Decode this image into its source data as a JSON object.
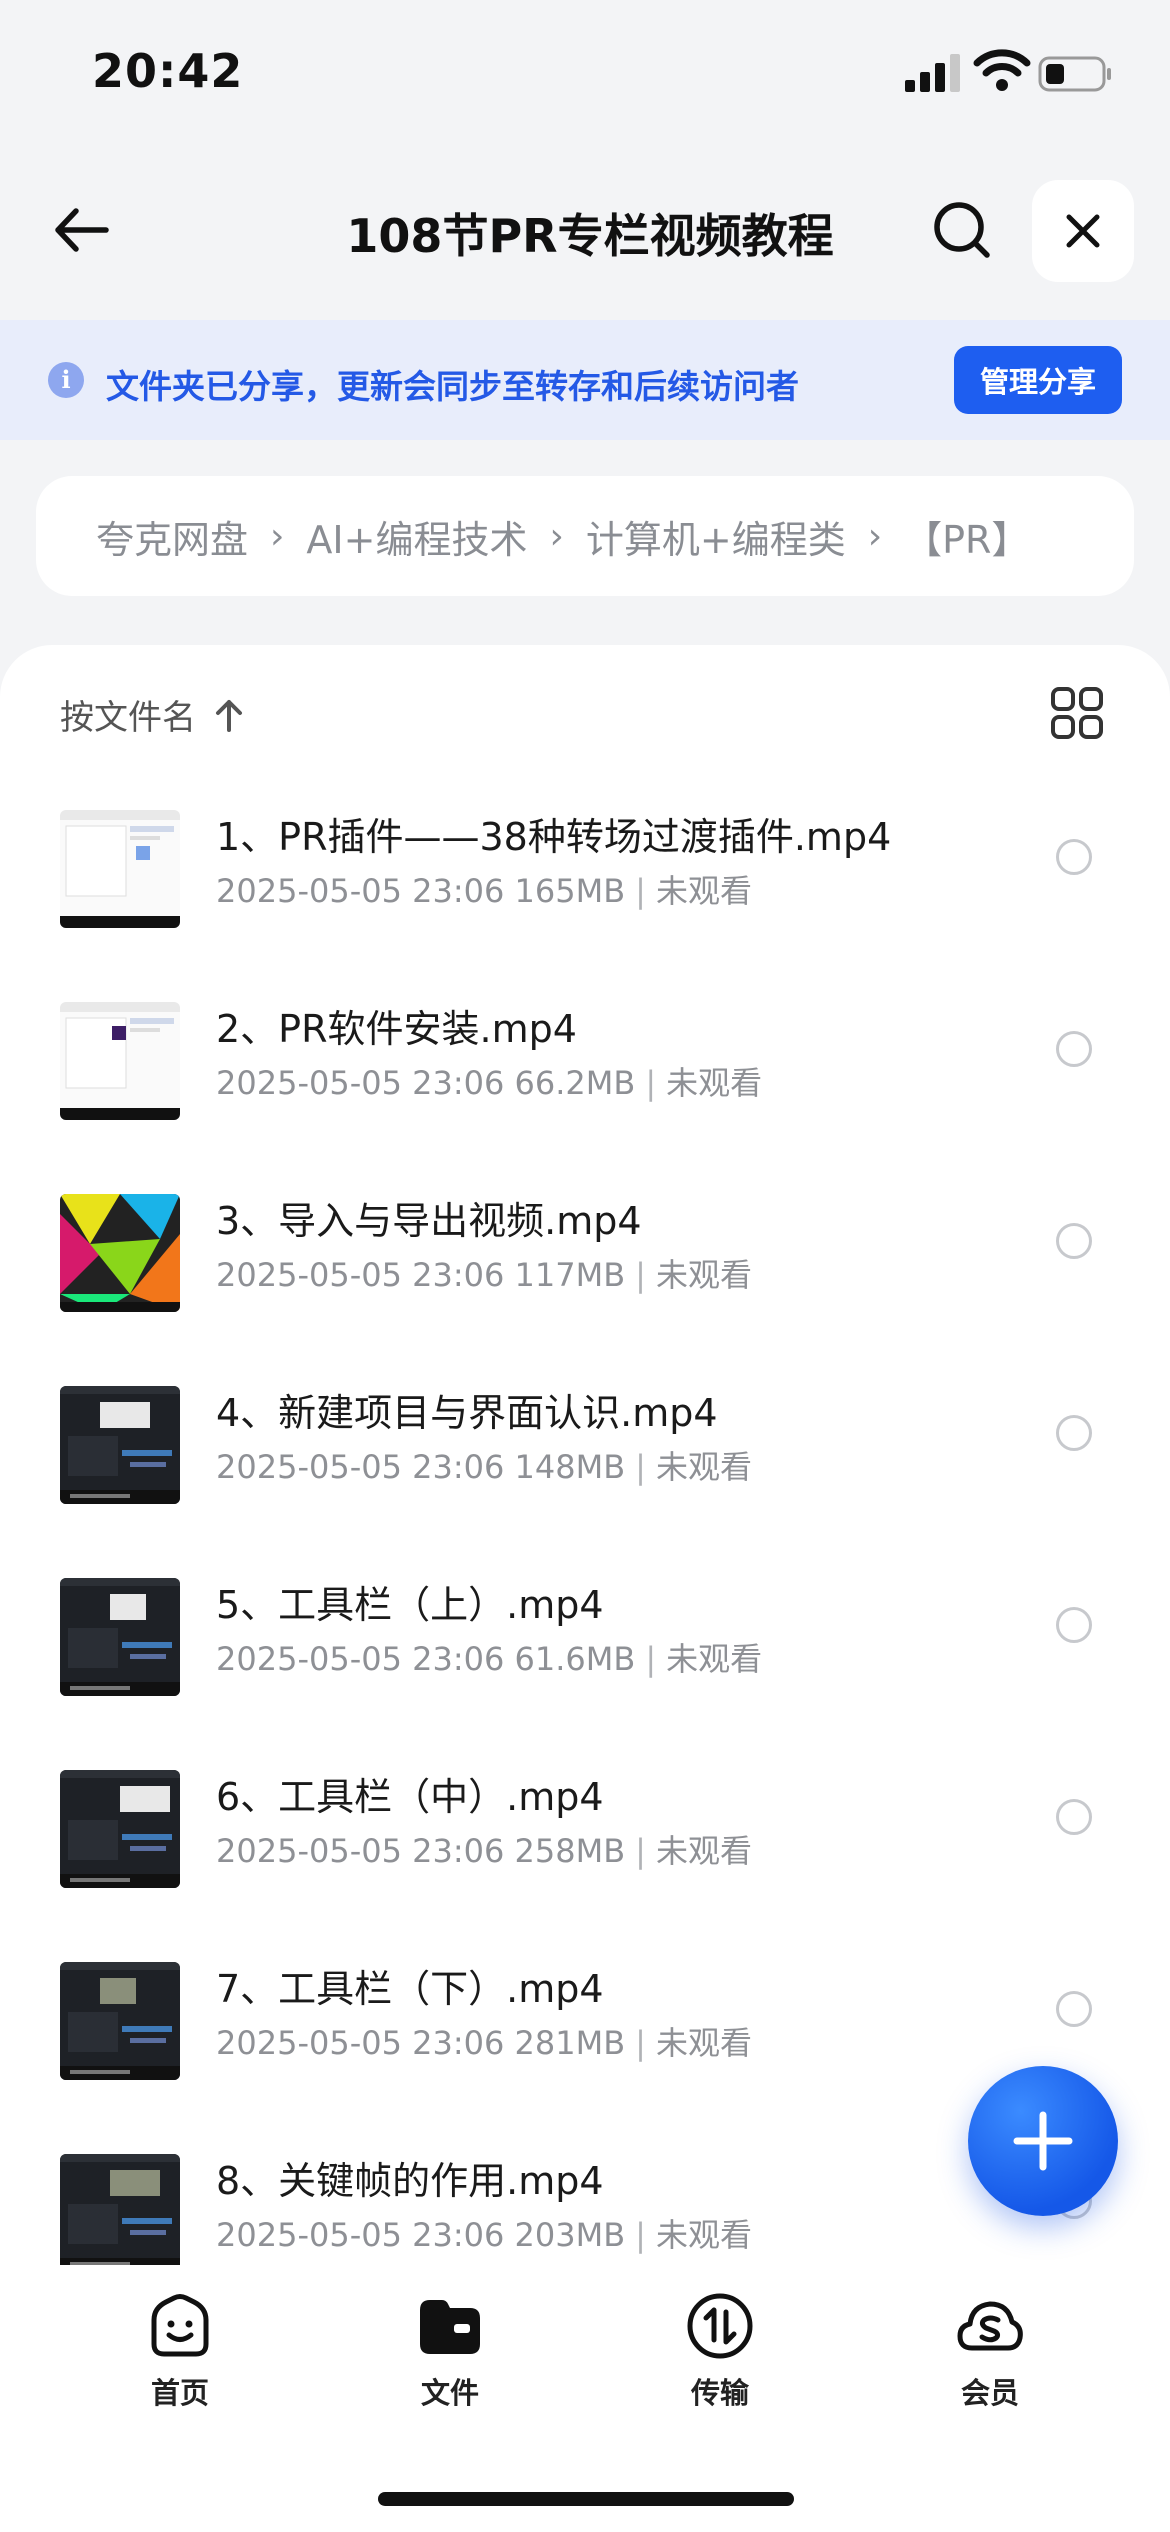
{
  "status_bar": {
    "time": "20:42"
  },
  "nav": {
    "title": "108节PR专栏视频教程"
  },
  "share_banner": {
    "text": "文件夹已分享，更新会同步至转存和后续访问者",
    "button": "管理分享"
  },
  "breadcrumb": {
    "items": [
      "夸克网盘",
      "AI+编程技术",
      "计算机+编程类",
      "【PR】"
    ],
    "separator": "›"
  },
  "sort": {
    "label": "按文件名"
  },
  "files": [
    {
      "name": "1、PR插件——38种转场过渡插件.mp4",
      "date": "2025-05-05 23:06",
      "size": "165MB",
      "status": "未观看",
      "thumb": "light"
    },
    {
      "name": "2、PR软件安装.mp4",
      "date": "2025-05-05 23:06",
      "size": "66.2MB",
      "status": "未观看",
      "thumb": "light"
    },
    {
      "name": "3、导入与导出视频.mp4",
      "date": "2025-05-05 23:06",
      "size": "117MB",
      "status": "未观看",
      "thumb": "colorful"
    },
    {
      "name": "4、新建项目与界面认识.mp4",
      "date": "2025-05-05 23:06",
      "size": "148MB",
      "status": "未观看",
      "thumb": "dark"
    },
    {
      "name": "5、工具栏（上）.mp4",
      "date": "2025-05-05 23:06",
      "size": "61.6MB",
      "status": "未观看",
      "thumb": "dark"
    },
    {
      "name": "6、工具栏（中）.mp4",
      "date": "2025-05-05 23:06",
      "size": "258MB",
      "status": "未观看",
      "thumb": "dark"
    },
    {
      "name": "7、工具栏（下）.mp4",
      "date": "2025-05-05 23:06",
      "size": "281MB",
      "status": "未观看",
      "thumb": "dark"
    },
    {
      "name": "8、关键帧的作用.mp4",
      "date": "2025-05-05 23:06",
      "size": "203MB",
      "status": "未观看",
      "thumb": "dark"
    }
  ],
  "tabs": [
    {
      "label": "首页",
      "icon": "home-face-icon"
    },
    {
      "label": "文件",
      "icon": "folder-icon"
    },
    {
      "label": "传输",
      "icon": "transfer-icon"
    },
    {
      "label": "会员",
      "icon": "vip-cloud-icon"
    }
  ],
  "colors": {
    "accent": "#1e5ef0",
    "banner_bg": "#e8edfb",
    "banner_text": "#2459e6"
  }
}
